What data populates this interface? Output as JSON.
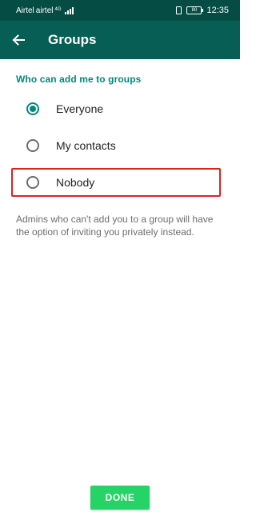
{
  "status_bar": {
    "carrier": "Airtel",
    "carrier2": "airtel",
    "network": "4G",
    "battery": "80",
    "time": "12:35"
  },
  "app_bar": {
    "back_icon": "arrow-left-icon",
    "title": "Groups"
  },
  "section": {
    "header": "Who can add me to groups"
  },
  "options": [
    {
      "label": "Everyone",
      "selected": true
    },
    {
      "label": "My contacts",
      "selected": false
    },
    {
      "label": "Nobody",
      "selected": false,
      "highlighted": true
    }
  ],
  "footnote": "Admins who can't add you to a group will have the option of inviting you privately instead.",
  "done_button": {
    "label": "DONE"
  },
  "colors": {
    "status_bar": "#054d44",
    "app_bar": "#075e54",
    "accent": "#00897b",
    "done_button": "#25d366",
    "highlight": "#e02020"
  }
}
